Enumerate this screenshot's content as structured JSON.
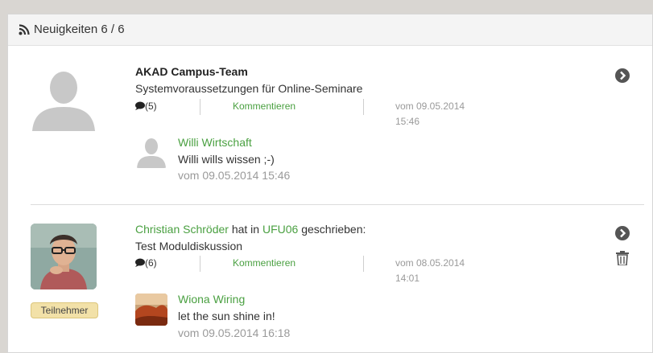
{
  "header": {
    "title": "Neuigkeiten 6 / 6"
  },
  "entries": [
    {
      "author": "AKAD Campus-Team",
      "subject": "Systemvoraussetzungen für Online-Seminare",
      "comment_count": "(5)",
      "comment_action": "Kommentieren",
      "date_line1": "vom 09.05.2014",
      "date_line2": "15:46",
      "reply": {
        "author": "Willi Wirtschaft",
        "text": "Willi wills wissen ;-)",
        "date": "vom 09.05.2014 15:46"
      }
    },
    {
      "author": "Christian Schröder",
      "middle": "hat in",
      "course": "UFU06",
      "suffix": "geschrieben:",
      "subject": "Test Moduldiskussion",
      "badge": "Teilnehmer",
      "comment_count": "(6)",
      "comment_action": "Kommentieren",
      "date_line1": "vom 08.05.2014",
      "date_line2": "14:01",
      "reply": {
        "author": "Wiona Wiring",
        "text": "let the sun shine in!",
        "date": "vom 09.05.2014 16:18"
      }
    }
  ],
  "colors": {
    "accent_green": "#4aa041",
    "badge_bg": "#f2e1a8"
  }
}
